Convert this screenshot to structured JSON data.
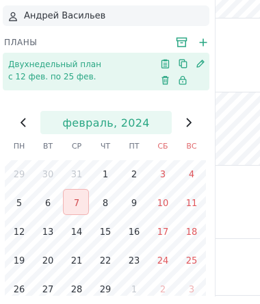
{
  "user": {
    "name": "Андрей Васильев",
    "icon": "user-icon"
  },
  "plans": {
    "title": "ПЛАНЫ",
    "actions": [
      {
        "icon": "archive-icon"
      },
      {
        "icon": "plus-icon"
      }
    ],
    "items": [
      {
        "name": "Двухнедельный план",
        "dates": "с 12 фев. по 25 фев.",
        "actions": [
          "clipboard-icon",
          "copy-icon",
          "edit-icon",
          "trash-icon",
          "lock-icon"
        ]
      }
    ]
  },
  "calendar": {
    "month_label": "февраль, 2024",
    "weekdays": [
      "ПН",
      "ВТ",
      "СР",
      "ЧТ",
      "ПТ",
      "СБ",
      "ВС"
    ],
    "weeks": [
      [
        "29",
        "30",
        "31",
        "1",
        "2",
        "3",
        "4"
      ],
      [
        "5",
        "6",
        "7",
        "8",
        "9",
        "10",
        "11"
      ],
      [
        "12",
        "13",
        "14",
        "15",
        "16",
        "17",
        "18"
      ],
      [
        "19",
        "20",
        "21",
        "22",
        "23",
        "24",
        "25"
      ],
      [
        "26",
        "27",
        "28",
        "29",
        "1",
        "2",
        "3"
      ]
    ],
    "today": "7"
  },
  "colors": {
    "accent": "#2aa784",
    "weekend": "#e0555a",
    "card_bg": "#e6f7f1"
  }
}
